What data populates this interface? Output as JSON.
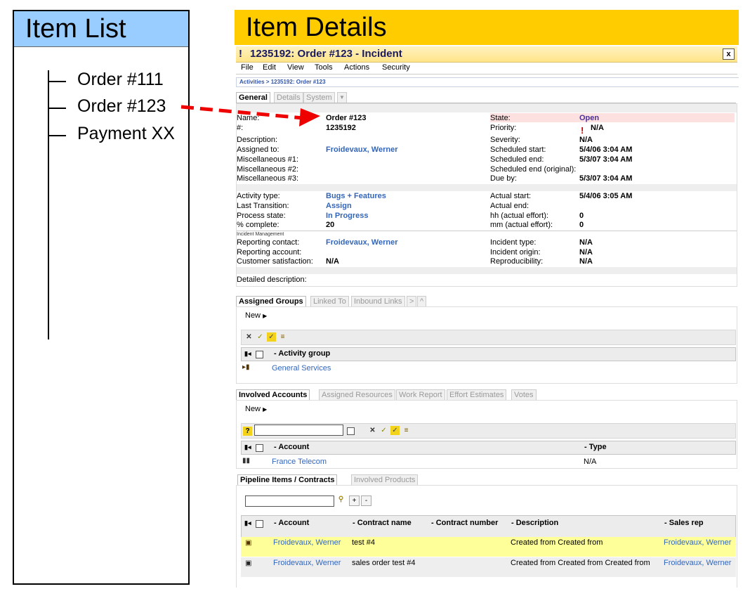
{
  "left": {
    "title": "Item List",
    "items": [
      "Order #111",
      "Order #123",
      "Payment XX"
    ]
  },
  "right": {
    "title": "Item Details"
  },
  "window": {
    "title_icon": "!",
    "title": "1235192: Order #123 - Incident",
    "close": "x",
    "menu": [
      "File",
      "Edit",
      "View",
      "Tools",
      "Actions",
      "Security"
    ],
    "breadcrumb": "Activities > 1235192: Order #123"
  },
  "tabs": [
    "General",
    "Details",
    "System"
  ],
  "general": {
    "name_label": "Name:",
    "name_value": "Order #123",
    "num_label": "#:",
    "num_value": "1235192",
    "state_label": "State:",
    "state_value": "Open",
    "priority_label": "Priority:",
    "priority_icon": "!",
    "priority_value": "N/A",
    "description_label": "Description:",
    "severity_label": "Severity:",
    "severity_value": "N/A",
    "assigned_label": "Assigned to:",
    "assigned_value": "Froidevaux, Werner",
    "sched_start_label": "Scheduled start:",
    "sched_start_value": "5/4/06 3:04 AM",
    "misc1_label": "Miscellaneous #1:",
    "sched_end_label": "Scheduled end:",
    "sched_end_value": "5/3/07 3:04 AM",
    "misc2_label": "Miscellaneous #2:",
    "sched_end_orig_label": "Scheduled end (original):",
    "misc3_label": "Miscellaneous #3:",
    "due_label": "Due by:",
    "due_value": "5/3/07 3:04 AM",
    "activity_type_label": "Activity type:",
    "activity_type_value": "Bugs + Features",
    "actual_start_label": "Actual start:",
    "actual_start_value": "5/4/06 3:05 AM",
    "last_transition_label": "Last Transition:",
    "last_transition_value": "Assign",
    "actual_end_label": "Actual end:",
    "process_state_label": "Process state:",
    "process_state_value": "In Progress",
    "hh_label": "hh (actual effort):",
    "hh_value": "0",
    "pct_label": "% complete:",
    "pct_value": "20",
    "mm_label": "mm (actual effort):",
    "mm_value": "0",
    "incident_mgmt_label": "Incident Management",
    "reporting_contact_label": "Reporting contact:",
    "reporting_contact_value": "Froidevaux, Werner",
    "incident_type_label": "Incident type:",
    "incident_type_value": "N/A",
    "reporting_account_label": "Reporting account:",
    "incident_origin_label": "Incident origin:",
    "incident_origin_value": "N/A",
    "customer_sat_label": "Customer satisfaction:",
    "customer_sat_value": "N/A",
    "reproducibility_label": "Reproducibility:",
    "reproducibility_value": "N/A",
    "detailed_desc_label": "Detailed description:"
  },
  "groups": {
    "tabs": [
      "Assigned Groups",
      "Linked To",
      "Inbound Links",
      ">",
      "^"
    ],
    "new_label": "New",
    "col": "Activity group",
    "rows": [
      "General Services"
    ]
  },
  "accounts": {
    "tabs": [
      "Involved Accounts",
      "Assigned Resources",
      "Work Report",
      "Effort Estimates",
      "Votes"
    ],
    "new_label": "New",
    "search_icon": "?",
    "cols": [
      "Account",
      "Type"
    ],
    "rows": [
      {
        "account": "France Telecom",
        "type": "N/A"
      }
    ]
  },
  "pipeline": {
    "tabs": [
      "Pipeline Items / Contracts",
      "Involved Products"
    ],
    "plus": "+",
    "minus": "-",
    "cols": [
      "Account",
      "Contract name",
      "Contract number",
      "Description",
      "Sales rep"
    ],
    "rows": [
      {
        "account": "Froidevaux, Werner",
        "contract_name": "test #4",
        "contract_number": "",
        "description": "Created from Created from",
        "sales_rep": "Froidevaux, Werner"
      },
      {
        "account": "Froidevaux, Werner",
        "contract_name": "sales order test #4",
        "contract_number": "",
        "description": "Created from Created from Created from",
        "sales_rep": "Froidevaux, Werner"
      }
    ]
  },
  "colors": {
    "left_header": "#99ccff",
    "right_header": "#ffcc00",
    "arrow": "#ee0000",
    "link": "#3366bb",
    "highlight_row": "#ffff99"
  }
}
